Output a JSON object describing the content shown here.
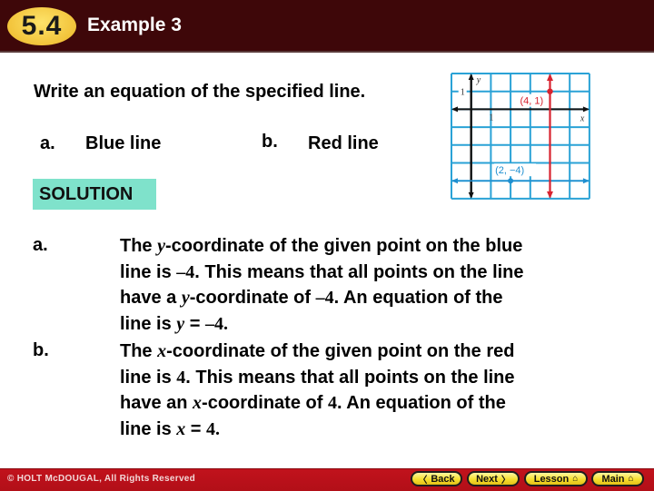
{
  "header": {
    "section_badge": "5.4",
    "title": "Example 3"
  },
  "prompt": "Write an equation of the specified line.",
  "parts": [
    {
      "label": "a.",
      "text": "Blue line"
    },
    {
      "label": "b.",
      "text": "Red line"
    }
  ],
  "solution_label": "SOLUTION",
  "solutions": [
    {
      "label": "a.",
      "lines": [
        [
          "The ",
          {
            "var": "y"
          },
          "-coordinate of the given point on the blue"
        ],
        [
          "line is ",
          {
            "num": "–4"
          },
          ". This means that all points on the line"
        ],
        [
          "have a ",
          {
            "var": "y"
          },
          "-coordinate of ",
          {
            "num": "–4"
          },
          ". An equation of the"
        ],
        [
          "line is ",
          {
            "var": "y"
          },
          " = ",
          {
            "num": "–4."
          }
        ]
      ]
    },
    {
      "label": "b.",
      "lines": [
        [
          "The ",
          {
            "var": "x"
          },
          "-coordinate of the given point on the red"
        ],
        [
          "line is ",
          {
            "num": "4"
          },
          ". This means that all points on the line"
        ],
        [
          "have an ",
          {
            "var": "x"
          },
          "-coordinate of ",
          {
            "num": "4"
          },
          ". An equation of the"
        ],
        [
          "line is ",
          {
            "var": "x"
          },
          " = ",
          {
            "num": "4."
          }
        ]
      ]
    }
  ],
  "graph": {
    "x_range": [
      -1,
      6
    ],
    "y_range": [
      -5,
      2
    ],
    "x_axis_label": "x",
    "y_axis_label": "y",
    "x_tick_label": "1",
    "y_tick_label": "1",
    "blue_line": {
      "equation": "y = -4",
      "point": [
        2,
        -4
      ],
      "point_label": "(2, −4)",
      "color": "#1f8fd0"
    },
    "red_line": {
      "equation": "x = 4",
      "point": [
        4,
        1
      ],
      "point_label": "(4, 1)",
      "color": "#d8232f"
    },
    "grid_color": "#2aa2d6"
  },
  "footer": {
    "copyright": "© HOLT McDOUGAL, All Rights Reserved",
    "buttons": [
      {
        "label": "Back",
        "icon": "chevron-left-icon",
        "glyph": "〈"
      },
      {
        "label": "Next",
        "icon": "chevron-right-icon",
        "glyph": "〉"
      },
      {
        "label": "Lesson",
        "icon": "home-icon",
        "glyph": "⌂"
      },
      {
        "label": "Main",
        "icon": "home-icon",
        "glyph": "⌂"
      }
    ]
  }
}
